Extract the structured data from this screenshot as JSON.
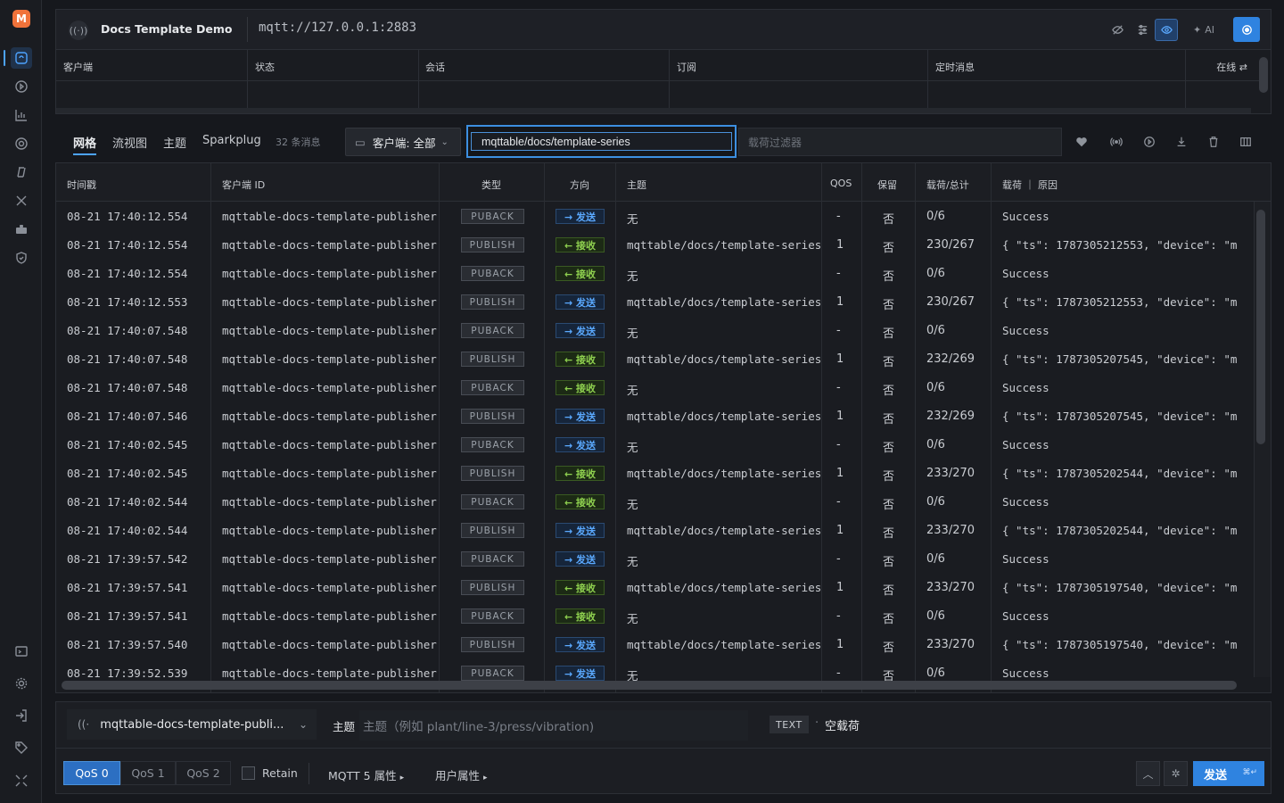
{
  "app": {
    "logo_letter": "M"
  },
  "topbar": {
    "connection_name": "Docs Template Demo",
    "url": "mqtt://127.0.0.1:2883",
    "ai_label": "AI"
  },
  "status_table": {
    "columns": [
      "客户端",
      "状态",
      "会话",
      "订阅",
      "定时消息"
    ],
    "online_label": "在线"
  },
  "toolbar": {
    "tabs": [
      "网格",
      "流视图",
      "主题",
      "Sparkplug"
    ],
    "active_tab": "网格",
    "message_count": "32 条消息",
    "client_filter": "客户端: 全部",
    "topic_filter_value": "mqttable/docs/template-series",
    "payload_filter_placeholder": "载荷过滤器"
  },
  "grid": {
    "headers": [
      "时间戳",
      "客户端 ID",
      "类型",
      "方向",
      "主题",
      "QOS",
      "保留",
      "载荷/总计",
      "载荷 ｜ 原因"
    ],
    "rows": [
      {
        "ts": "08-21 17:40:12.554",
        "client": "mqttable-docs-template-publisher",
        "type": "PUBACK",
        "dir": "→ 发送",
        "dir_kind": "send",
        "topic": "无",
        "qos": "-",
        "retain": "否",
        "size": "0/6",
        "payload": "Success"
      },
      {
        "ts": "08-21 17:40:12.554",
        "client": "mqttable-docs-template-publisher",
        "type": "PUBLISH",
        "dir": "← 接收",
        "dir_kind": "recv",
        "topic": "mqttable/docs/template-series",
        "qos": "1",
        "retain": "否",
        "size": "230/267",
        "payload": "{ \"ts\": 1787305212553, \"device\": \"m"
      },
      {
        "ts": "08-21 17:40:12.554",
        "client": "mqttable-docs-template-publisher",
        "type": "PUBACK",
        "dir": "← 接收",
        "dir_kind": "recv",
        "topic": "无",
        "qos": "-",
        "retain": "否",
        "size": "0/6",
        "payload": "Success"
      },
      {
        "ts": "08-21 17:40:12.553",
        "client": "mqttable-docs-template-publisher",
        "type": "PUBLISH",
        "dir": "→ 发送",
        "dir_kind": "send",
        "topic": "mqttable/docs/template-series",
        "qos": "1",
        "retain": "否",
        "size": "230/267",
        "payload": "{ \"ts\": 1787305212553, \"device\": \"m"
      },
      {
        "ts": "08-21 17:40:07.548",
        "client": "mqttable-docs-template-publisher",
        "type": "PUBACK",
        "dir": "→ 发送",
        "dir_kind": "send",
        "topic": "无",
        "qos": "-",
        "retain": "否",
        "size": "0/6",
        "payload": "Success"
      },
      {
        "ts": "08-21 17:40:07.548",
        "client": "mqttable-docs-template-publisher",
        "type": "PUBLISH",
        "dir": "← 接收",
        "dir_kind": "recv",
        "topic": "mqttable/docs/template-series",
        "qos": "1",
        "retain": "否",
        "size": "232/269",
        "payload": "{ \"ts\": 1787305207545, \"device\": \"m"
      },
      {
        "ts": "08-21 17:40:07.548",
        "client": "mqttable-docs-template-publisher",
        "type": "PUBACK",
        "dir": "← 接收",
        "dir_kind": "recv",
        "topic": "无",
        "qos": "-",
        "retain": "否",
        "size": "0/6",
        "payload": "Success"
      },
      {
        "ts": "08-21 17:40:07.546",
        "client": "mqttable-docs-template-publisher",
        "type": "PUBLISH",
        "dir": "→ 发送",
        "dir_kind": "send",
        "topic": "mqttable/docs/template-series",
        "qos": "1",
        "retain": "否",
        "size": "232/269",
        "payload": "{ \"ts\": 1787305207545, \"device\": \"m"
      },
      {
        "ts": "08-21 17:40:02.545",
        "client": "mqttable-docs-template-publisher",
        "type": "PUBACK",
        "dir": "→ 发送",
        "dir_kind": "send",
        "topic": "无",
        "qos": "-",
        "retain": "否",
        "size": "0/6",
        "payload": "Success"
      },
      {
        "ts": "08-21 17:40:02.545",
        "client": "mqttable-docs-template-publisher",
        "type": "PUBLISH",
        "dir": "← 接收",
        "dir_kind": "recv",
        "topic": "mqttable/docs/template-series",
        "qos": "1",
        "retain": "否",
        "size": "233/270",
        "payload": "{ \"ts\": 1787305202544, \"device\": \"m"
      },
      {
        "ts": "08-21 17:40:02.544",
        "client": "mqttable-docs-template-publisher",
        "type": "PUBACK",
        "dir": "← 接收",
        "dir_kind": "recv",
        "topic": "无",
        "qos": "-",
        "retain": "否",
        "size": "0/6",
        "payload": "Success"
      },
      {
        "ts": "08-21 17:40:02.544",
        "client": "mqttable-docs-template-publisher",
        "type": "PUBLISH",
        "dir": "→ 发送",
        "dir_kind": "send",
        "topic": "mqttable/docs/template-series",
        "qos": "1",
        "retain": "否",
        "size": "233/270",
        "payload": "{ \"ts\": 1787305202544, \"device\": \"m"
      },
      {
        "ts": "08-21 17:39:57.542",
        "client": "mqttable-docs-template-publisher",
        "type": "PUBACK",
        "dir": "→ 发送",
        "dir_kind": "send",
        "topic": "无",
        "qos": "-",
        "retain": "否",
        "size": "0/6",
        "payload": "Success"
      },
      {
        "ts": "08-21 17:39:57.541",
        "client": "mqttable-docs-template-publisher",
        "type": "PUBLISH",
        "dir": "← 接收",
        "dir_kind": "recv",
        "topic": "mqttable/docs/template-series",
        "qos": "1",
        "retain": "否",
        "size": "233/270",
        "payload": "{ \"ts\": 1787305197540, \"device\": \"m"
      },
      {
        "ts": "08-21 17:39:57.541",
        "client": "mqttable-docs-template-publisher",
        "type": "PUBACK",
        "dir": "← 接收",
        "dir_kind": "recv",
        "topic": "无",
        "qos": "-",
        "retain": "否",
        "size": "0/6",
        "payload": "Success"
      },
      {
        "ts": "08-21 17:39:57.540",
        "client": "mqttable-docs-template-publisher",
        "type": "PUBLISH",
        "dir": "→ 发送",
        "dir_kind": "send",
        "topic": "mqttable/docs/template-series",
        "qos": "1",
        "retain": "否",
        "size": "233/270",
        "payload": "{ \"ts\": 1787305197540, \"device\": \"m"
      },
      {
        "ts": "08-21 17:39:52.539",
        "client": "mqttable-docs-template-publisher",
        "type": "PUBACK",
        "dir": "→ 发送",
        "dir_kind": "send",
        "topic": "无",
        "qos": "-",
        "retain": "否",
        "size": "0/6",
        "payload": "Success"
      }
    ]
  },
  "composer": {
    "client": "mqttable-docs-template-publi...",
    "topic_label": "主题",
    "topic_placeholder": "主题（例如 plant/line-3/press/vibration)",
    "format": "TEXT",
    "separator": "·",
    "empty_payload": "空载荷",
    "qos_options": [
      "QoS 0",
      "QoS 1",
      "QoS 2"
    ],
    "qos_selected": "QoS 0",
    "retain_label": "Retain",
    "mqtt5_props": "MQTT 5 属性",
    "user_props": "用户属性",
    "send_label": "发送",
    "send_shortcut": "⌘↵"
  },
  "colors": {
    "accent": "#2f83e0",
    "send": "#5aa9ff",
    "recv": "#8fd14f",
    "brand": "#f0723a"
  }
}
